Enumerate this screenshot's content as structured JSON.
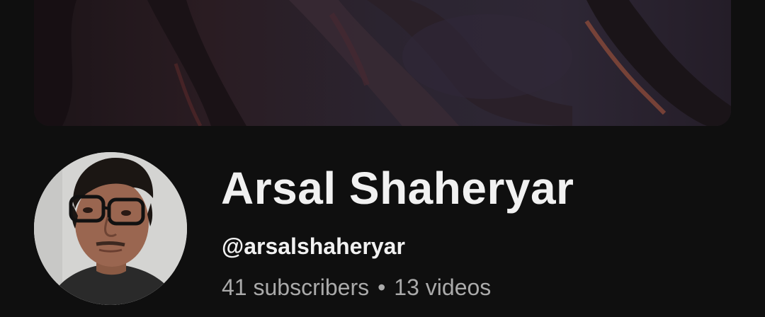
{
  "channel": {
    "name": "Arsal Shaheryar",
    "handle": "@arsalshaheryar",
    "subscribers": "41 subscribers",
    "separator": "•",
    "videos": "13 videos"
  },
  "colors": {
    "background": "#0f0f0f",
    "primary_text": "#f1f1f1",
    "secondary_text": "#aaaaaa"
  }
}
